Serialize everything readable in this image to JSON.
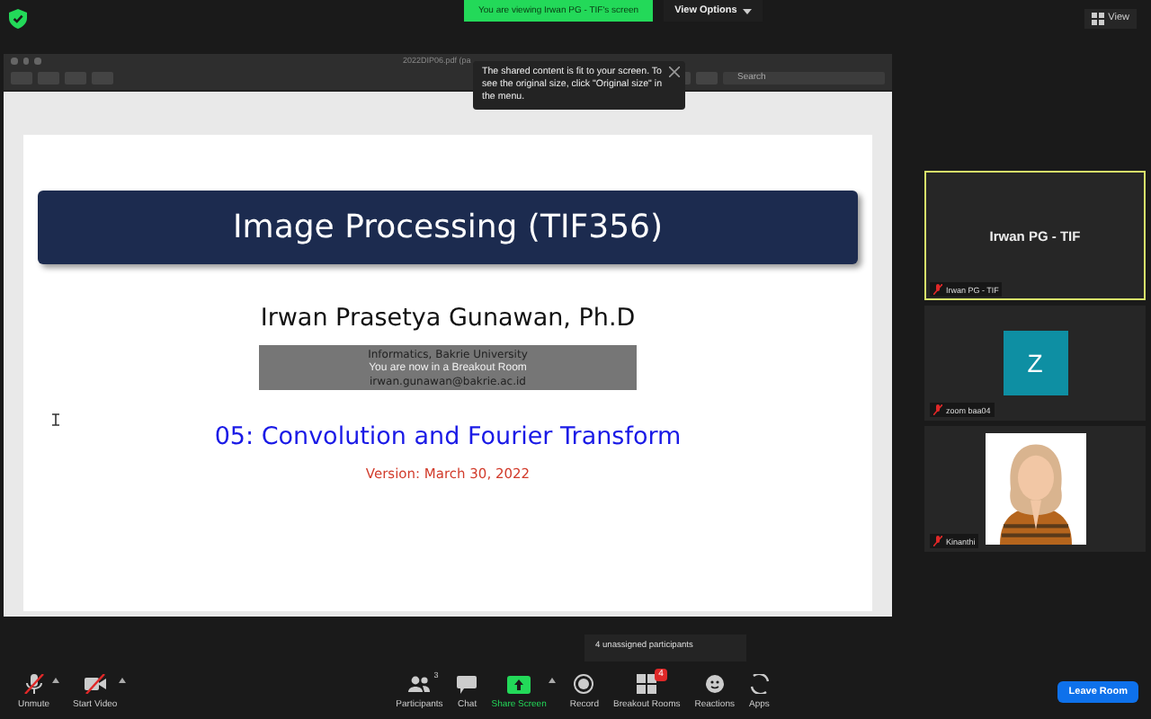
{
  "top_bar": {
    "viewing_banner": "You are viewing Irwan PG - TIF's screen",
    "view_options": "View Options",
    "view_button": "View"
  },
  "notice": {
    "text": "The shared content is fit to your screen. To see the original size, click \"Original size\" in the menu."
  },
  "shared_window": {
    "title": "2022DIP06.pdf (pa",
    "search_placeholder": "Search"
  },
  "slide": {
    "title": "Image Processing (TIF356)",
    "author": "Irwan Prasetya Gunawan, Ph.D",
    "affiliation": "Informatics, Bakrie University",
    "email": "irwan.gunawan@bakrie.ac.id",
    "subtitle": "05: Convolution and Fourier Transform",
    "version": "Version: March 30, 2022"
  },
  "breakout_notice": "You are now in a Breakout Room",
  "tiles": [
    {
      "kind": "name",
      "display": "Irwan PG - TIF",
      "label": "Irwan PG - TIF",
      "speaking": true,
      "muted": true
    },
    {
      "kind": "avatar",
      "display": "Z",
      "label": "zoom baa04",
      "speaking": false,
      "muted": true
    },
    {
      "kind": "picture",
      "label": "Kinanthi",
      "speaking": false,
      "muted": true
    }
  ],
  "unassigned_tooltip": "4 unassigned participants",
  "toolbar": [
    {
      "kind": "mic",
      "label": "Unmute",
      "off": true,
      "caret": true
    },
    {
      "kind": "video",
      "label": "Start Video",
      "off": true,
      "caret": true
    },
    {
      "kind": "participants",
      "label": "Participants",
      "count": "3"
    },
    {
      "kind": "chat",
      "label": "Chat"
    },
    {
      "kind": "share",
      "label": "Share Screen",
      "caret": true
    },
    {
      "kind": "record",
      "label": "Record"
    },
    {
      "kind": "breakout",
      "label": "Breakout Rooms",
      "badge": "4"
    },
    {
      "kind": "reactions",
      "label": "Reactions"
    },
    {
      "kind": "apps",
      "label": "Apps"
    }
  ],
  "leave_button": "Leave Room"
}
